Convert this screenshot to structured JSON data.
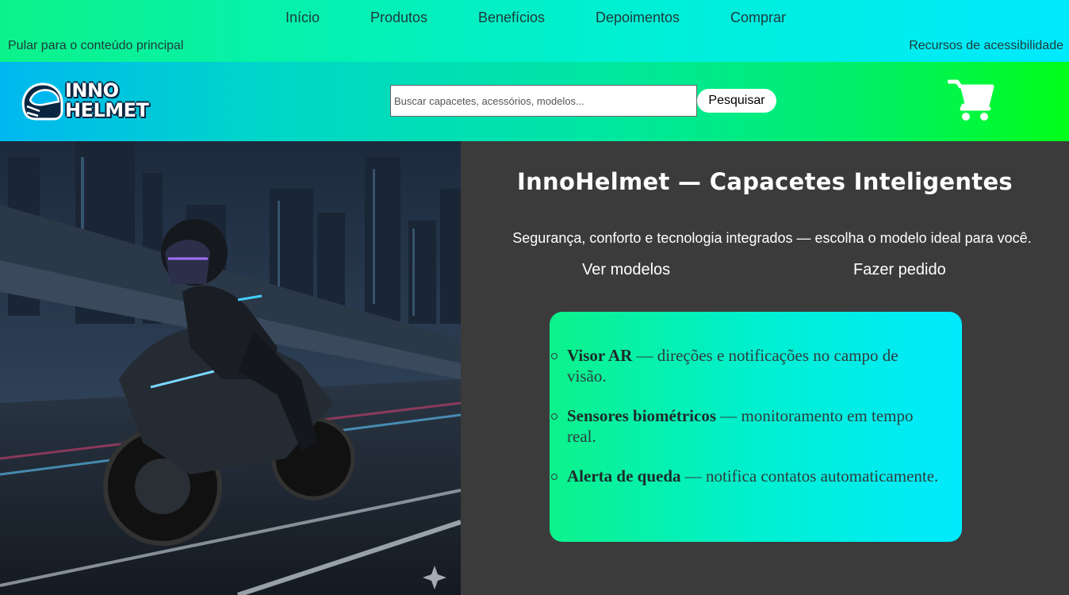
{
  "topnav": {
    "items": [
      "Início",
      "Produtos",
      "Benefícios",
      "Depoimentos",
      "Comprar"
    ],
    "skip_link": "Pular para o conteúdo principal",
    "accessibility_link": "Recursos de acessibilidade"
  },
  "header": {
    "logo_line1": "INNO",
    "logo_line2": "HELMET",
    "search_placeholder": "Buscar capacetes, acessórios, modelos...",
    "search_button": "Pesquisar",
    "cart_icon": "shopping-cart-icon"
  },
  "hero": {
    "title": "InnoHelmet — Capacetes Inteligentes",
    "subtitle": "Segurança, conforto e tecnologia integrados — escolha o modelo ideal para você.",
    "cta_primary": "Ver modelos",
    "cta_secondary": "Fazer pedido",
    "features": [
      {
        "name": "Visor AR",
        "desc": " — direções e notificações no campo de visão."
      },
      {
        "name": "Sensores biométricos",
        "desc": " — monitoramento em tempo real."
      },
      {
        "name": "Alerta de queda",
        "desc": " — notifica contatos automaticamente."
      }
    ]
  },
  "colors": {
    "accent_green": "#0cf28a",
    "accent_cyan": "#00eaff",
    "dark_bg": "#3b3b3b"
  }
}
